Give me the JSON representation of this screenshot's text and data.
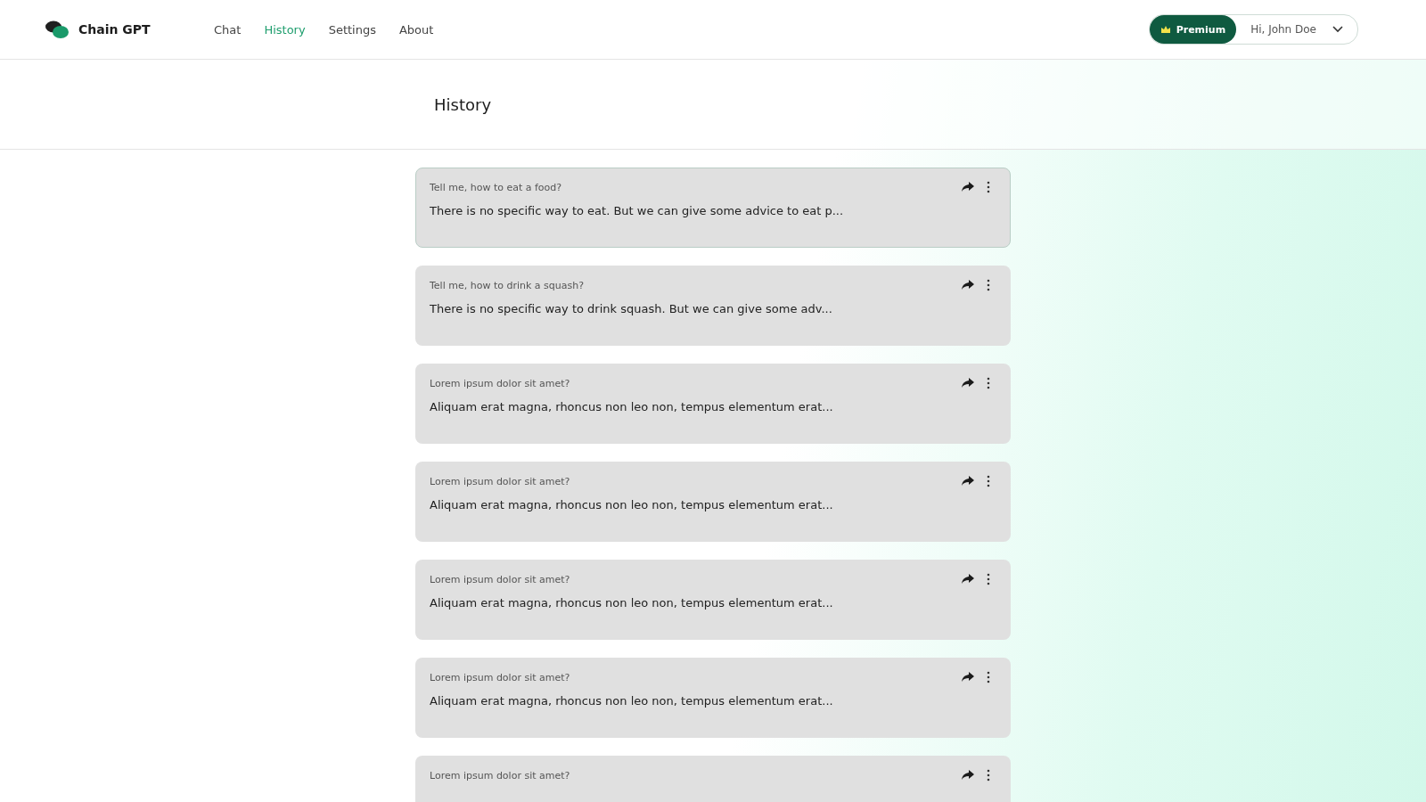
{
  "brand": {
    "name": "Chain GPT"
  },
  "nav": [
    {
      "label": "Chat",
      "selected": false
    },
    {
      "label": "History",
      "selected": true
    },
    {
      "label": "Settings",
      "selected": false
    },
    {
      "label": "About",
      "selected": false
    }
  ],
  "premium": {
    "label": "Premium"
  },
  "user": {
    "greeting": "Hi, John Doe"
  },
  "page": {
    "title": "History"
  },
  "history": [
    {
      "question": "Tell me, how to eat a food?",
      "answer": "There is no specific way to eat. But we can give some advice to eat p...",
      "selected": true
    },
    {
      "question": "Tell me, how to drink a squash?",
      "answer": "There is no specific way to drink squash. But we can give some adv...",
      "selected": false
    },
    {
      "question": "Lorem ipsum dolor sit amet?",
      "answer": "Aliquam erat magna, rhoncus non leo non, tempus elementum erat...",
      "selected": false
    },
    {
      "question": "Lorem ipsum dolor sit amet?",
      "answer": "Aliquam erat magna, rhoncus non leo non, tempus elementum erat...",
      "selected": false
    },
    {
      "question": "Lorem ipsum dolor sit amet?",
      "answer": "Aliquam erat magna, rhoncus non leo non, tempus elementum erat...",
      "selected": false
    },
    {
      "question": "Lorem ipsum dolor sit amet?",
      "answer": "Aliquam erat magna, rhoncus non leo non, tempus elementum erat...",
      "selected": false
    },
    {
      "question": "Lorem ipsum dolor sit amet?",
      "selected": false
    }
  ]
}
